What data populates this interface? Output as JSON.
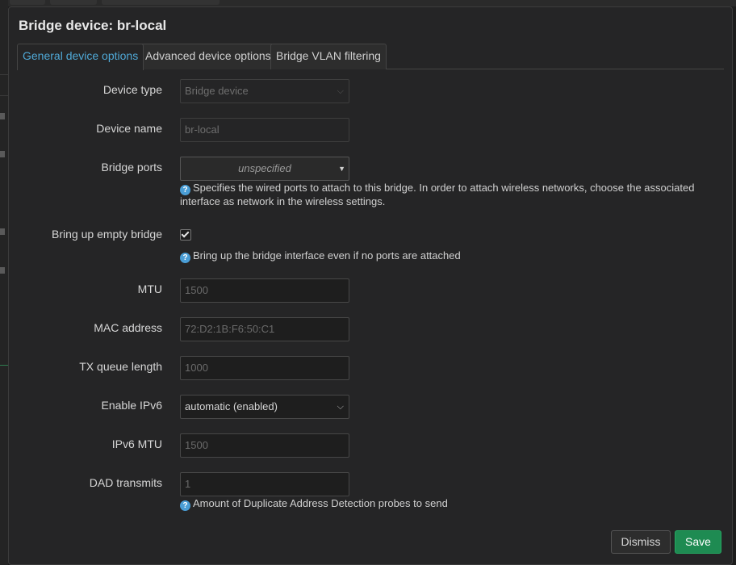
{
  "dialog": {
    "title": "Bridge device: br-local"
  },
  "tabs": [
    {
      "label": "General device options",
      "active": true
    },
    {
      "label": "Advanced device options",
      "active": false
    },
    {
      "label": "Bridge VLAN filtering",
      "active": false
    }
  ],
  "form": {
    "device_type": {
      "label": "Device type",
      "value": "Bridge device"
    },
    "device_name": {
      "label": "Device name",
      "value": "br-local"
    },
    "bridge_ports": {
      "label": "Bridge ports",
      "value": "unspecified",
      "help_line1": "Specifies the wired ports to attach to this bridge. In order to attach wireless networks, choose the associated",
      "help_line2": "interface as network in the wireless settings."
    },
    "bring_up_empty": {
      "label": "Bring up empty bridge",
      "checked": true,
      "help": "Bring up the bridge interface even if no ports are attached"
    },
    "mtu": {
      "label": "MTU",
      "placeholder": "1500"
    },
    "mac": {
      "label": "MAC address",
      "placeholder": "72:D2:1B:F6:50:C1"
    },
    "txqueuelen": {
      "label": "TX queue length",
      "placeholder": "1000"
    },
    "ipv6": {
      "label": "Enable IPv6",
      "value": "automatic (enabled)"
    },
    "ipv6_mtu": {
      "label": "IPv6 MTU",
      "placeholder": "1500"
    },
    "dad": {
      "label": "DAD transmits",
      "placeholder": "1",
      "help": "Amount of Duplicate Address Detection probes to send"
    }
  },
  "help_icon_glyph": "?",
  "buttons": {
    "dismiss": "Dismiss",
    "save": "Save"
  },
  "colors": {
    "accent": "#4fa8d6",
    "save": "#1e8b52",
    "background": "#252526"
  }
}
